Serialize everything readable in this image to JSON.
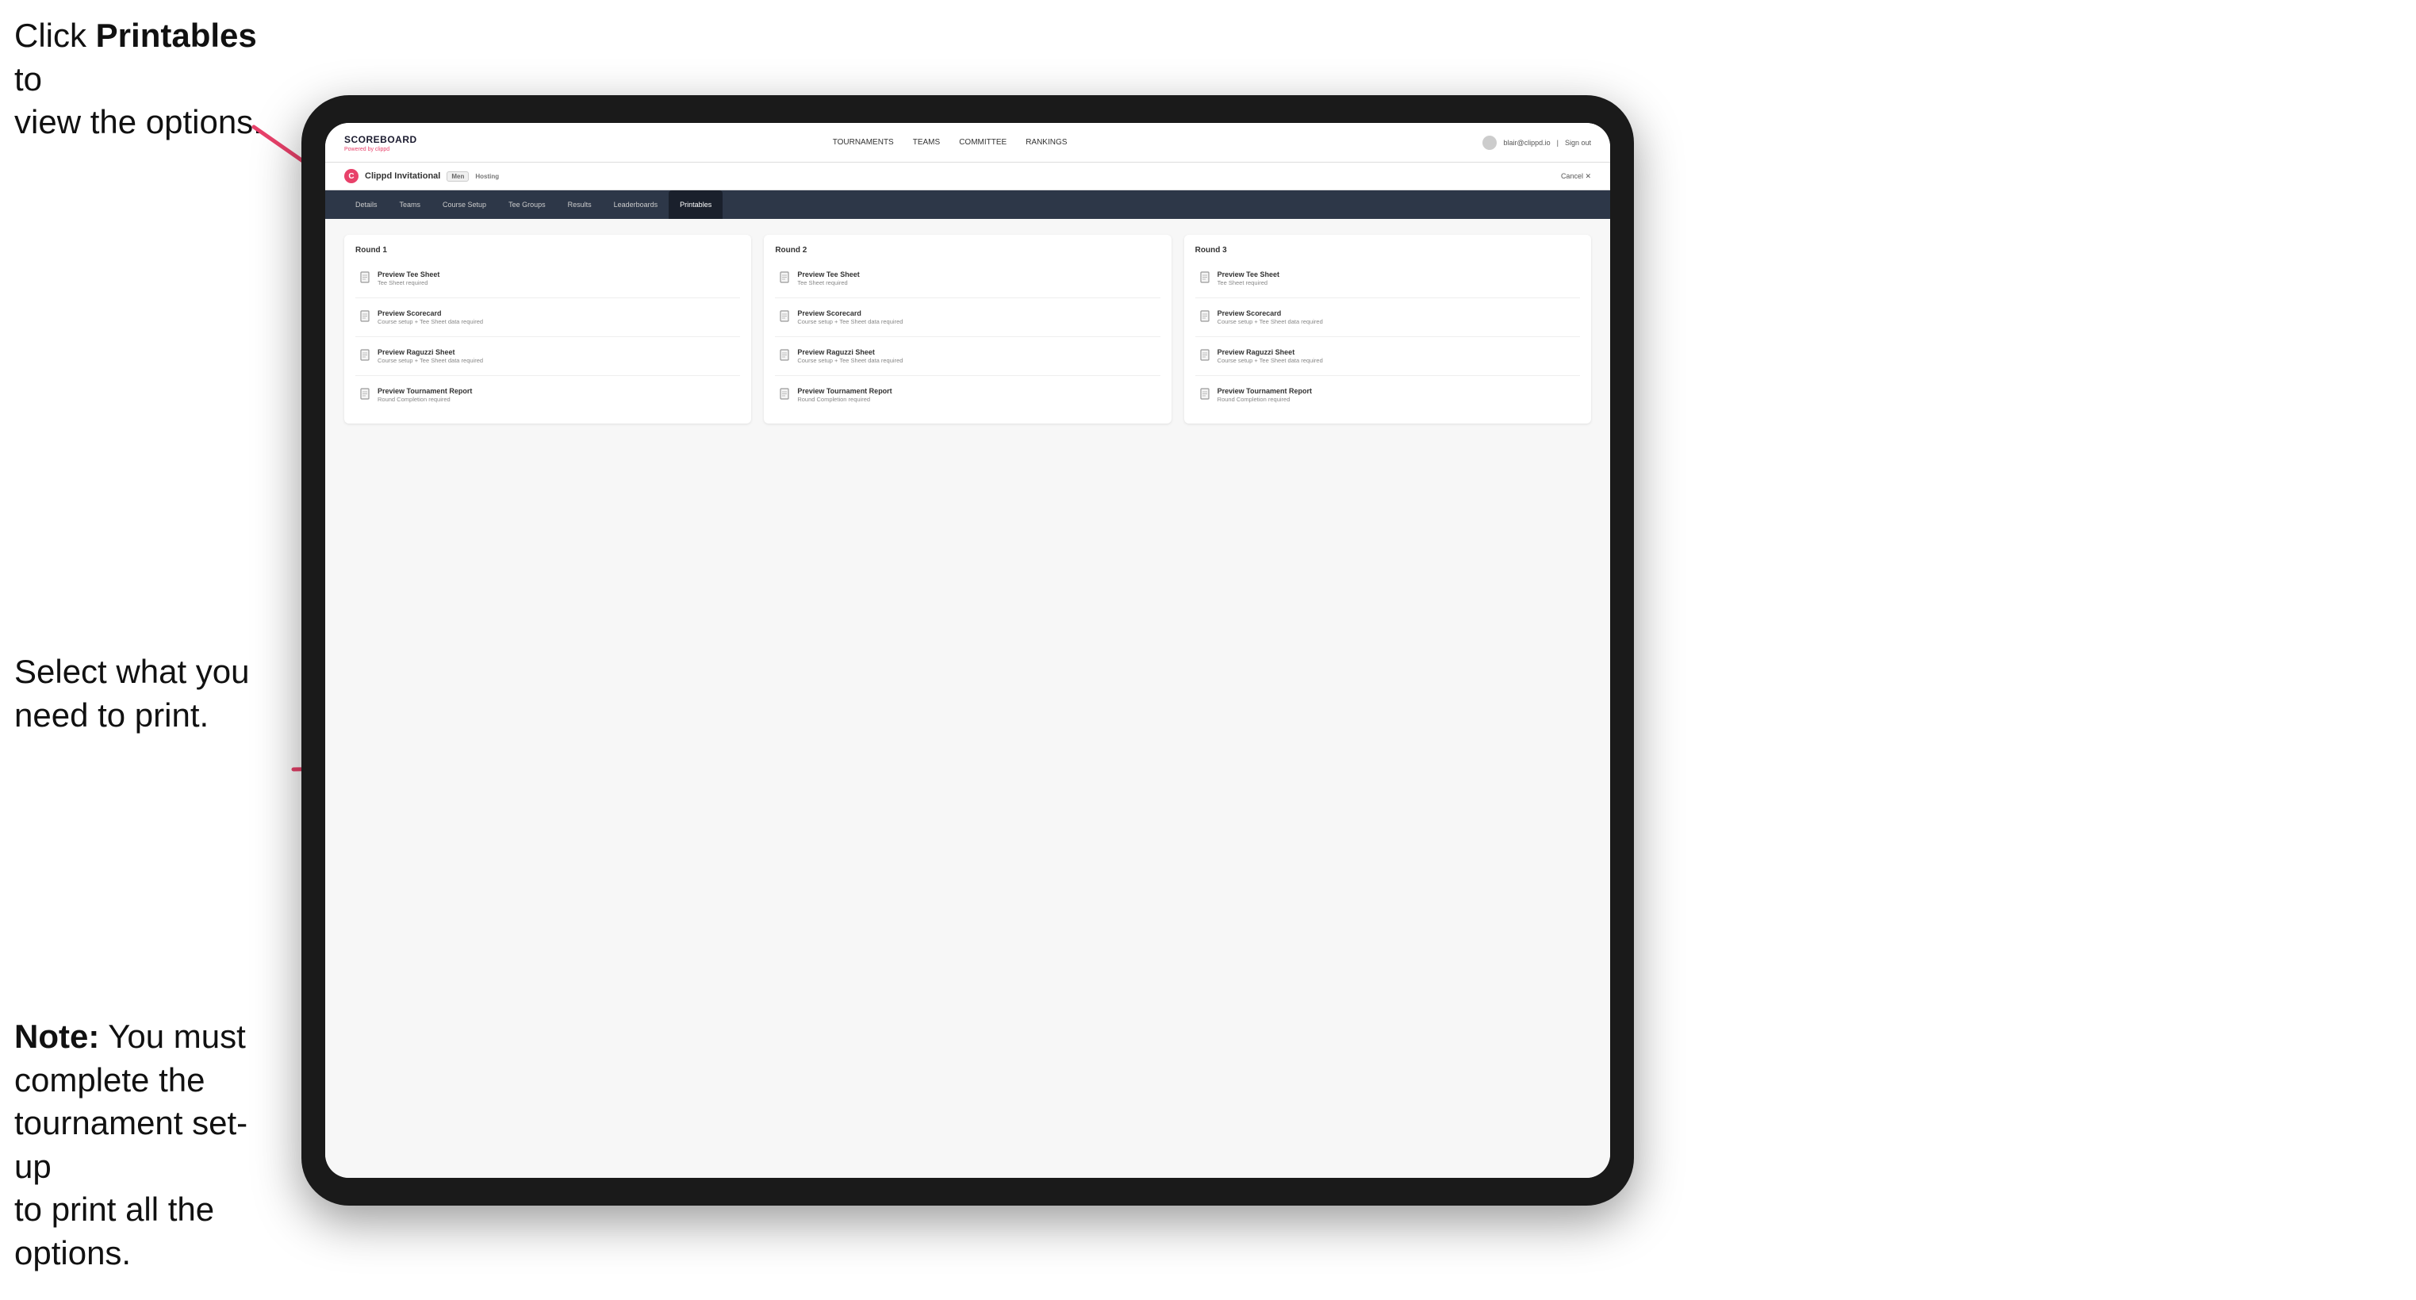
{
  "annotations": {
    "top": {
      "part1": "Click ",
      "bold": "Printables",
      "part2": " to\nview the options."
    },
    "middle": "Select what you\nneed to print.",
    "bottom": {
      "bold": "Note:",
      "rest": " You must\ncomplete the\ntournament set-up\nto print all the options."
    }
  },
  "nav": {
    "brand": "SCOREBOARD",
    "brand_sub": "Powered by clippd",
    "links": [
      {
        "label": "TOURNAMENTS",
        "active": false
      },
      {
        "label": "TEAMS",
        "active": false
      },
      {
        "label": "COMMITTEE",
        "active": false
      },
      {
        "label": "RANKINGS",
        "active": false
      }
    ],
    "user_email": "blair@clippd.io",
    "sign_out": "Sign out"
  },
  "tournament": {
    "logo_letter": "C",
    "name": "Clippd Invitational",
    "bracket": "Men",
    "status": "Hosting",
    "cancel_label": "Cancel ✕"
  },
  "sub_tabs": [
    {
      "label": "Details",
      "active": false
    },
    {
      "label": "Teams",
      "active": false
    },
    {
      "label": "Course Setup",
      "active": false
    },
    {
      "label": "Tee Groups",
      "active": false
    },
    {
      "label": "Results",
      "active": false
    },
    {
      "label": "Leaderboards",
      "active": false
    },
    {
      "label": "Printables",
      "active": true
    }
  ],
  "rounds": [
    {
      "title": "Round 1",
      "items": [
        {
          "title": "Preview Tee Sheet",
          "subtitle": "Tee Sheet required"
        },
        {
          "title": "Preview Scorecard",
          "subtitle": "Course setup + Tee Sheet data required"
        },
        {
          "title": "Preview Raguzzi Sheet",
          "subtitle": "Course setup + Tee Sheet data required"
        },
        {
          "title": "Preview Tournament Report",
          "subtitle": "Round Completion required"
        }
      ]
    },
    {
      "title": "Round 2",
      "items": [
        {
          "title": "Preview Tee Sheet",
          "subtitle": "Tee Sheet required"
        },
        {
          "title": "Preview Scorecard",
          "subtitle": "Course setup + Tee Sheet data required"
        },
        {
          "title": "Preview Raguzzi Sheet",
          "subtitle": "Course setup + Tee Sheet data required"
        },
        {
          "title": "Preview Tournament Report",
          "subtitle": "Round Completion required"
        }
      ]
    },
    {
      "title": "Round 3",
      "items": [
        {
          "title": "Preview Tee Sheet",
          "subtitle": "Tee Sheet required"
        },
        {
          "title": "Preview Scorecard",
          "subtitle": "Course setup + Tee Sheet data required"
        },
        {
          "title": "Preview Raguzzi Sheet",
          "subtitle": "Course setup + Tee Sheet data required"
        },
        {
          "title": "Preview Tournament Report",
          "subtitle": "Round Completion required"
        }
      ]
    }
  ]
}
